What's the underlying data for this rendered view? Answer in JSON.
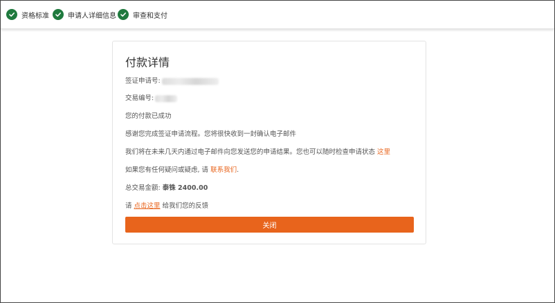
{
  "steps": [
    {
      "label": "资格标准",
      "status": "done",
      "icon": "check-circle-icon"
    },
    {
      "label": "申请人详细信息",
      "status": "done",
      "icon": "check-circle-icon"
    },
    {
      "label": "审查和支付",
      "status": "done",
      "icon": "check-circle-icon"
    }
  ],
  "colors": {
    "step_done": "#1f7a3e",
    "accent": "#e8641c",
    "text": "#555555",
    "title": "#333333"
  },
  "card": {
    "title": "付款详情",
    "visa_no_label": "签证申请号:",
    "txn_no_label": "交易编号:",
    "success_text": "您的付款已成功",
    "thanks_text": "感谢您完成签证申请流程。您将很快收到一封确认电子邮件",
    "result_text": "我们将在未来几天内通过电子邮件向您发送您的申请结果。您也可以随时检查申请状态",
    "result_link": "这里",
    "contact_prefix": "如果您有任何疑问或疑虑, 请",
    "contact_link": "联系我们",
    "contact_suffix": ".",
    "amount_label": "总交易金额:",
    "amount_value": "泰铢 2400.00",
    "feedback_prefix": "请",
    "feedback_link": "点击这里",
    "feedback_suffix": "给我们您的反馈",
    "close_label": "关闭"
  }
}
